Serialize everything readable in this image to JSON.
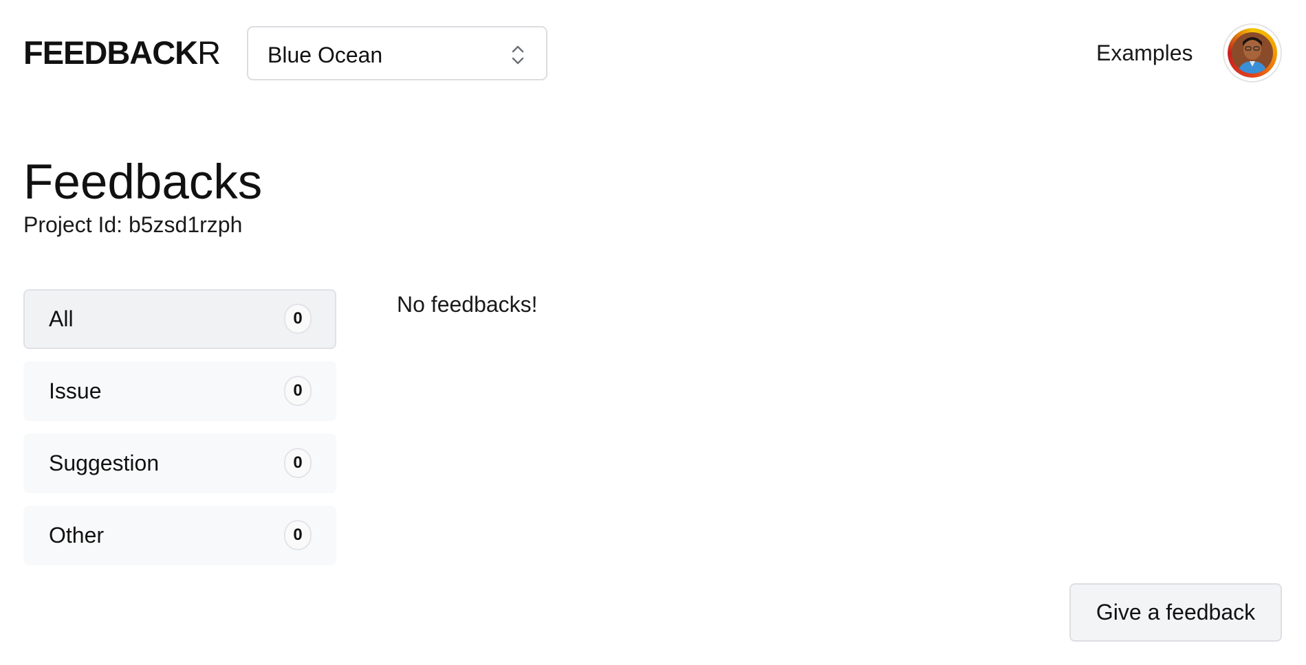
{
  "header": {
    "logo_bold": "FEEDBACK",
    "logo_light": "R",
    "project_select": {
      "value": "Blue Ocean",
      "icon": "chevron-up-down-icon"
    },
    "examples_label": "Examples",
    "avatar": {
      "icon": "user-avatar",
      "ring_colors": [
        "#f4c300",
        "#f29b00",
        "#e2421b",
        "#c71f1f"
      ]
    }
  },
  "main": {
    "title": "Feedbacks",
    "project_id_label": "Project Id:",
    "project_id_value": "b5zsd1rzph",
    "filters": [
      {
        "label": "All",
        "count": "0",
        "active": true
      },
      {
        "label": "Issue",
        "count": "0",
        "active": false
      },
      {
        "label": "Suggestion",
        "count": "0",
        "active": false
      },
      {
        "label": "Other",
        "count": "0",
        "active": false
      }
    ],
    "empty_message": "No feedbacks!"
  },
  "footer": {
    "feedback_button_label": "Give a feedback"
  },
  "colors": {
    "background": "#ffffff",
    "text": "#111111",
    "filter_bg": "#f8f9fa",
    "filter_active_bg": "#f1f2f4",
    "border": "#dcdde0"
  }
}
